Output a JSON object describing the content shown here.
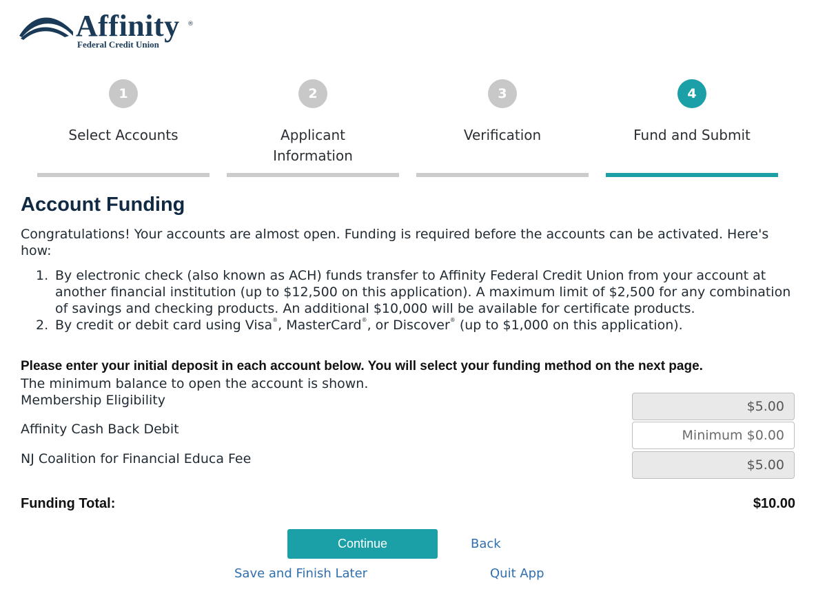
{
  "brand": {
    "name": "Affinity",
    "registered": "®",
    "subtitle": "Federal Credit Union"
  },
  "steps": [
    {
      "number": "1",
      "label": "Select Accounts",
      "active": false
    },
    {
      "number": "2",
      "label": "Applicant Information",
      "active": false
    },
    {
      "number": "3",
      "label": "Verification",
      "active": false
    },
    {
      "number": "4",
      "label": "Fund and Submit",
      "active": true
    }
  ],
  "main": {
    "title": "Account Funding",
    "intro": "Congratulations! Your accounts are almost open. Funding is required before the accounts can be activated. Here's how:",
    "methods": [
      {
        "num": "1.",
        "text": "By electronic check (also known as ACH) funds transfer to Affinity Federal Credit Union from your account at another financial institution (up to $12,500 on this application). A maximum limit of $2,500 for any combination of savings and checking products. An additional $10,000 will be available for certificate products."
      },
      {
        "num": "2.",
        "pre": "By credit or debit card using Visa",
        "mid1": ", MasterCard",
        "mid2": ", or Discover",
        "post": " (up to $1,000 on this application).",
        "reg": "®"
      }
    ],
    "deposit_prompt": "Please enter your initial deposit in each account below. You will select your funding method on the next page.",
    "min_note": "The minimum balance to open the account is shown.",
    "accounts": [
      {
        "label": "Membership Eligibility",
        "value": "$5.00",
        "placeholder": "",
        "editable": false
      },
      {
        "label": "Affinity Cash Back Debit",
        "value": "",
        "placeholder": "Minimum $0.00",
        "editable": true
      },
      {
        "label": "NJ Coalition for Financial Educa Fee",
        "value": "$5.00",
        "placeholder": "",
        "editable": false
      }
    ],
    "total_label": "Funding Total:",
    "total_value": "$10.00"
  },
  "actions": {
    "continue": "Continue",
    "back": "Back",
    "save": "Save and Finish Later",
    "quit": "Quit App"
  },
  "colors": {
    "accent": "#1aa0a6",
    "inactive": "#c8c8c8",
    "link": "#2f6fb0",
    "brand": "#1b3a57"
  }
}
